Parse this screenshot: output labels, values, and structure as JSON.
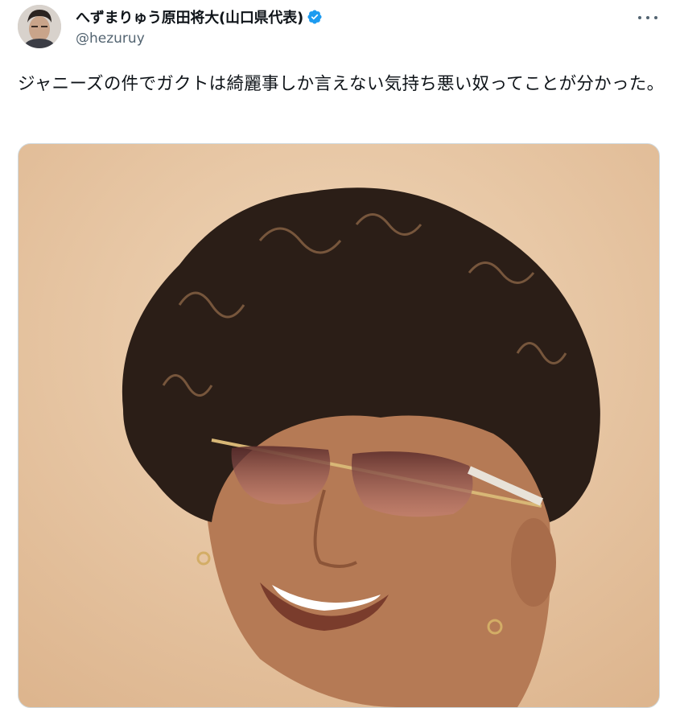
{
  "tweet": {
    "display_name": "へずまりゅう原田将大(山口県代表)",
    "handle": "@hezuruy",
    "text": "ジャニーズの件でガクトは綺麗事しか言えない気持ち悪い奴ってことが分かった。",
    "verified": true,
    "verified_color": "#1d9bf0"
  },
  "icons": {
    "verified": "verified-badge-icon",
    "more": "more-options-icon"
  },
  "colors": {
    "text": "#0f1419",
    "secondary": "#536471",
    "media_background": "#e9c9a6"
  }
}
